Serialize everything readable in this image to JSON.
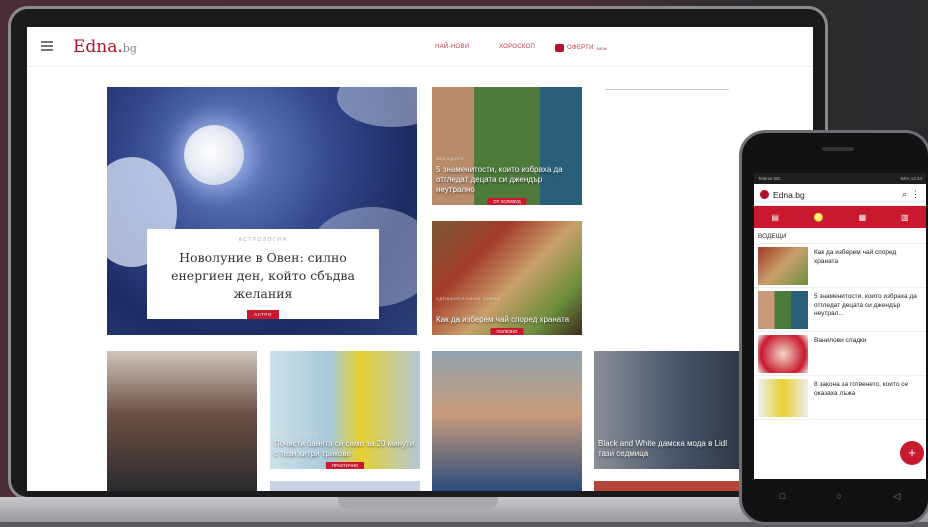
{
  "site": {
    "logo": "Edna.",
    "logo_suffix": "bg",
    "nav": [
      "НАЙ-НОВИ",
      "ХОРОСКОП",
      "ОФЕРТИ"
    ],
    "nav_badge": "NEW"
  },
  "hero": {
    "category": "АСТРОЛОГИЯ",
    "title": "Новолуние в Овен: силно енергиен ден, който сбъдва желания",
    "tag": "АСТРО"
  },
  "cards": [
    {
      "caption": "5 знаменитости, които избраха да отгледат децата си джендър неутрално",
      "tag": "ОТ ХОЛИВУД",
      "kicker": "ЗВЕЗДИТЕ"
    },
    {
      "caption": "Как да изберем чай според храната",
      "tag": "ПОЛЕЗНО",
      "kicker": "ЗДРАВОСЛОВНИ ХРАНИ"
    },
    {
      "caption": "",
      "tag": "",
      "kicker": ""
    },
    {
      "caption": "Почисти банята си само за 20 минути с тези хитри трикове",
      "tag": "ПРАКТИЧНО",
      "kicker": "ПОЛЕЗНИ ИДЕИ"
    },
    {
      "caption": "",
      "tag": "",
      "kicker": ""
    },
    {
      "caption": "Black and White дамска мода в Lidl тази седмица",
      "tag": "",
      "kicker": ""
    }
  ],
  "phone": {
    "status_left": "Telenor BG",
    "status_right": "62% 14:24",
    "title": "Edna.bg",
    "section": "ВОДЕЩИ",
    "items": [
      "Как да изберем чай според храната",
      "5 знаменитости, които избраха да отгледат децата си джендър неутрал...",
      "Ванилови сладки",
      "8 закона за готвенето, които се оказаха лъжа"
    ],
    "fab": "+"
  },
  "colors": {
    "brand": "#c8192f",
    "logo": "#b0122b"
  }
}
